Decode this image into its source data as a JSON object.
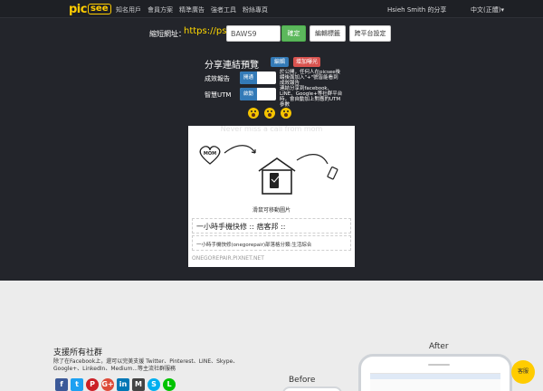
{
  "nav": {
    "logo_a": "pic",
    "logo_b": "see",
    "items": [
      "知名用戶",
      "會員方案",
      "精準廣告",
      "強者工具",
      "粉絲專頁"
    ],
    "user": "Hsieh Smith 的分享",
    "lang": "中文(正體)▾"
  },
  "shorten": {
    "label": "縮短網址：",
    "prefix": "https://pse.is/",
    "value": "BAWS9",
    "confirm": "確定",
    "edit_tag": "編輯標籤",
    "platform": "跨平台設定"
  },
  "preview": {
    "title": "分享連結預覽",
    "edit": "編輯",
    "add_exposure": "增加曝光",
    "options": [
      {
        "label": "成效報告",
        "toggle": "開通",
        "desc": "於公開，任何人在picsee後綴後面加入\"+\"號皆能看到成效報告"
      },
      {
        "label": "智慧UTM",
        "toggle": "啟動",
        "desc": "連結分享到facebook、LINE、Google+等社群平台時，會自動加上對應的UTM參數"
      }
    ],
    "emojis": [
      "scream-emoji",
      "scream-emoji",
      "scream-emoji"
    ]
  },
  "card": {
    "image_caption": "Never miss a call from mom",
    "drag_hint": "滑鼠可移動圖片",
    "title": "一小時手機快修 :: 痞客邦 ::",
    "desc": "一小時手機快修(onegorepair)部落格分類:生活綜合",
    "domain": "ONEGOREPAIR.PIXNET.NET"
  },
  "lower": {
    "social_title": "支援所有社群",
    "social_desc": "除了在Facebook上，還可以完美支援 Twitter、Pinterest、LINE、Skype、Google+、LinkedIn、Medium...等主流社群服務",
    "icons": [
      {
        "name": "facebook-icon",
        "glyph": "f",
        "color": "#3b5998"
      },
      {
        "name": "twitter-icon",
        "glyph": "t",
        "color": "#1da1f2"
      },
      {
        "name": "pinterest-icon",
        "glyph": "P",
        "color": "#cb2027"
      },
      {
        "name": "google-plus-icon",
        "glyph": "G+",
        "color": "#dd4b39"
      },
      {
        "name": "linkedin-icon",
        "glyph": "in",
        "color": "#0077b5"
      },
      {
        "name": "medium-icon",
        "glyph": "M",
        "color": "#444444"
      },
      {
        "name": "skype-icon",
        "glyph": "S",
        "color": "#00aff0"
      },
      {
        "name": "line-icon",
        "glyph": "L",
        "color": "#00c300"
      }
    ],
    "before": "Before",
    "after": "After",
    "fab": "客服"
  }
}
